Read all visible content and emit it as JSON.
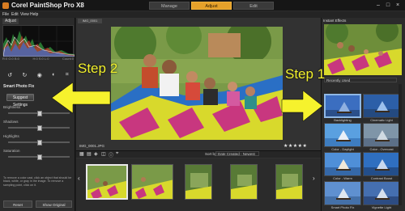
{
  "app": {
    "title": "Corel PaintShop Pro X8",
    "workspace_tabs": [
      "Manage",
      "Adjust",
      "Edit"
    ],
    "active_workspace": "Adjust",
    "window_controls": [
      "minimize-icon",
      "maximize-icon",
      "close-icon"
    ]
  },
  "menu": [
    "File",
    "Edit",
    "View",
    "Help"
  ],
  "left_panel": {
    "tab": "Adjust",
    "histogram_readout": [
      "R:0 G:0 B:0",
      "H:0 S:0 L:0",
      "Count:0"
    ],
    "tool_icons": [
      "rotate-left-icon",
      "rotate-right-icon",
      "red-eye-icon",
      "tone-icon",
      "crop-icon"
    ],
    "section_title": "Smart Photo Fix",
    "suggest_button": "Suggest Settings",
    "sliders": [
      {
        "label": "Brightness",
        "value": 0.5
      },
      {
        "label": "Shadows",
        "value": 0.5
      },
      {
        "label": "Highlights",
        "value": 0.5
      },
      {
        "label": "Saturation",
        "value": 0.5
      }
    ],
    "note": "To remove a color cast, click an object that should be black, white, or gray in the image. To remove a sampling point, click on it.",
    "buttons": [
      "Reset",
      "Show Original"
    ]
  },
  "center": {
    "file_tab": "IMG_0001",
    "filename": "IMG_0001.JPG",
    "rating": "★★★★★",
    "toolbar_icons": [
      "grid-view-icon",
      "folder-icon",
      "tag-icon",
      "compare-icon",
      "info-icon",
      "map-icon"
    ],
    "sort_label": "Sort by:",
    "sort_value": "Date Created - Newest",
    "filmstrip_count": 6
  },
  "right_panel": {
    "title": "Instant Effects",
    "category": "Recently Used",
    "presets": [
      {
        "label": "Backlighting",
        "selected": true
      },
      {
        "label": "Cinematic Light",
        "selected": false
      },
      {
        "label": "Color - Daylight",
        "selected": false
      },
      {
        "label": "Color - Overcast",
        "selected": false
      },
      {
        "label": "Color - Warm",
        "selected": false
      },
      {
        "label": "Contrast Boost",
        "selected": false
      },
      {
        "label": "Smart Photo Fix",
        "selected": false
      },
      {
        "label": "Vignette Light",
        "selected": false
      }
    ]
  },
  "annotations": {
    "step1": "Step 1",
    "step2": "Step 2",
    "arrow_color": "#f6f22d"
  }
}
